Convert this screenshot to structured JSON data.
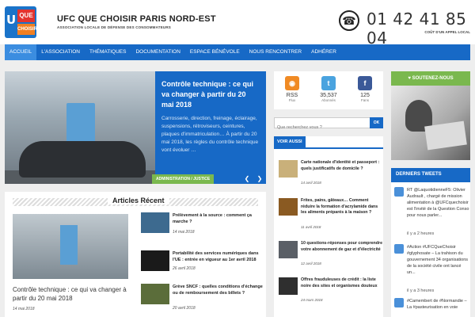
{
  "header": {
    "title": "UFC QUE CHOISIR PARIS NORD-EST",
    "subtitle": "ASSOCIATION LOCALE DE DÉFENSE DES CONSOMMATEURS",
    "phone": "01 42 41 85 04",
    "phone_note": "COÛT D'UN APPEL LOCAL",
    "logo": {
      "u": "U",
      "que": "QUE",
      "choisir": "CHOISIR"
    }
  },
  "nav": [
    "ACCUEIL",
    "L'ASSOCIATION",
    "THÉMATIQUES",
    "DOCUMENTATION",
    "ESPACE BÉNÉVOLE",
    "NOUS RENCONTRER",
    "ADHÉRER"
  ],
  "slider": {
    "title": "Contrôle technique : ce qui va changer à partir du 20 mai 2018",
    "excerpt": "Carrosserie, direction, freinage, éclairage, suspensions, rétroviseurs, ceintures, plaques d'immatriculation… À partir du 20 mai 2018, les règles du contrôle technique vont évoluer …",
    "category": "ADMINISTRATION / JUSTICE"
  },
  "recent": {
    "heading": "Articles Récent",
    "featured": {
      "title": "Contrôle technique : ce qui va changer à partir du 20 mai 2018",
      "date": "14 mai 2018"
    },
    "items": [
      {
        "title": "Prélèvement à la source : comment ça marche ?",
        "date": "14 mai 2018",
        "thumb": "#3d6a8f"
      },
      {
        "title": "Portabilité des services numériques dans l'UE : entrée en vigueur au 1er avril 2018",
        "date": "26 avril 2018",
        "thumb": "#1a1a1a"
      },
      {
        "title": "Grève SNCF : quelles conditions d'échange ou de remboursement des billets ?",
        "date": "20 avril 2018",
        "thumb": "#5b6d3a"
      }
    ]
  },
  "social": [
    {
      "name": "RSS",
      "count": "RSS",
      "label": "Flux",
      "icon": "rss-icon",
      "color": "#f08a24"
    },
    {
      "name": "Twitter",
      "count": "35,537",
      "label": "Abonnés",
      "icon": "twitter-icon",
      "color": "#4aa3df"
    },
    {
      "name": "Facebook",
      "count": "125",
      "label": "Fans",
      "icon": "facebook-icon",
      "color": "#3b5998"
    }
  ],
  "search": {
    "placeholder": "Que recherchez vous ?",
    "button": "OK"
  },
  "voir": {
    "tab": "VOIR AUSSI",
    "items": [
      {
        "title": "Carte nationale d'identité et passeport : quels justificatifs de domicile ?",
        "date": "14 avril 2018",
        "thumb": "#c9b07a"
      },
      {
        "title": "Frites, pains, gâteaux… Comment réduire la formation d'acrylamide dans les aliments préparés à la maison ?",
        "date": "11 avril 2018",
        "thumb": "#8a5a22"
      },
      {
        "title": "10 questions-réponses pour comprendre votre abonnement de gaz et d'électricité",
        "date": "12 avril 2018",
        "thumb": "#5a5f66"
      },
      {
        "title": "Offres frauduleuses de crédit : la liste noire des sites et organismes douteux",
        "date": "24 mars 2018",
        "thumb": "#2f2f2f"
      }
    ]
  },
  "support": {
    "label": "SOUTENEZ-NOUS"
  },
  "tweets": {
    "heading": "DERNIERS TWEETS",
    "items": [
      {
        "text": "RT @LaquotidienneF5: Olivier Audrault , chargé de mission alimentation à @UFCquechoisir est l'invité de la Question Conso pour nous parler...",
        "time": "il y a 2 heures"
      },
      {
        "text": "#Action #UFCQueChoisir #glyphosate – La trahison du gouvernement 34 organisations de la société civile ont lancé un...",
        "time": "il y a 3 heures"
      },
      {
        "text": "#Camembert de #Normandie – La #pasteurisation en voie",
        "time": ""
      }
    ]
  }
}
